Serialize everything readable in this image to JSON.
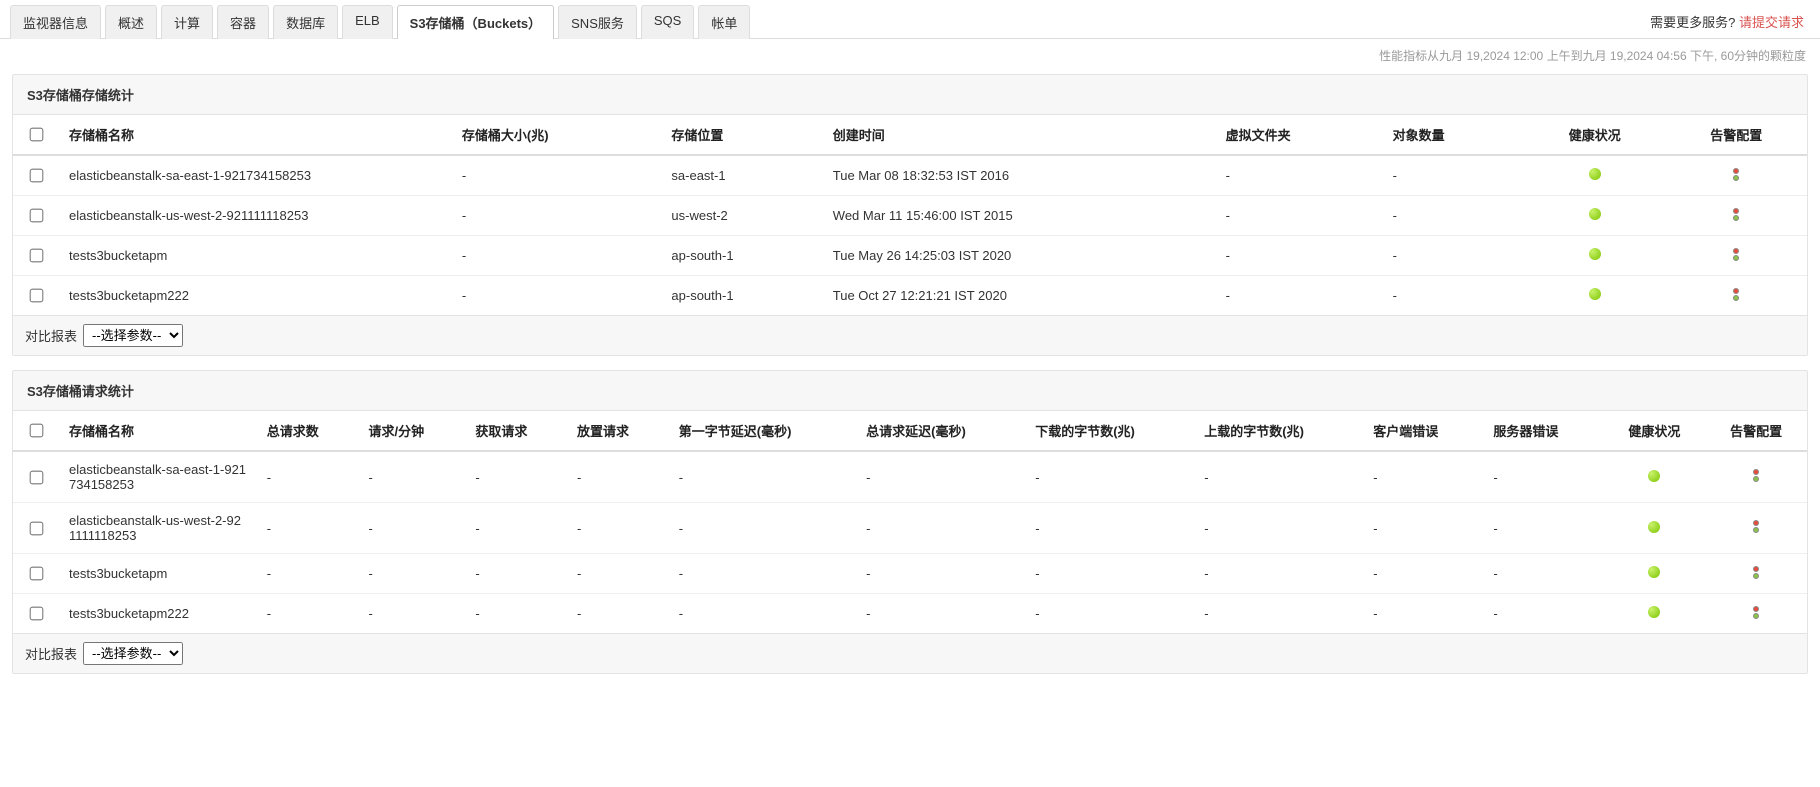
{
  "tabs": {
    "items": [
      "监视器信息",
      "概述",
      "计算",
      "容器",
      "数据库",
      "ELB",
      "S3存储桶（Buckets）",
      "SNS服务",
      "SQS",
      "帐单"
    ],
    "active_index": 6
  },
  "more_services": {
    "prefix": "需要更多服务? ",
    "link": "请提交请求"
  },
  "subbar": "性能指标从九月 19,2024 12:00 上午到九月 19,2024 04:56 下午,   60分钟的颗粒度",
  "storage_panel": {
    "title": "S3存储桶存储统计",
    "headers": [
      "存储桶名称",
      "存储桶大小(兆)",
      "存储位置",
      "创建时间",
      "虚拟文件夹",
      "对象数量",
      "健康状况",
      "告警配置"
    ],
    "rows": [
      {
        "name": "elasticbeanstalk-sa-east-1-921734158253",
        "size": "-",
        "location": "sa-east-1",
        "ctime": "Tue Mar 08 18:32:53 IST 2016",
        "vf": "-",
        "objs": "-"
      },
      {
        "name": "elasticbeanstalk-us-west-2-921111118253",
        "size": "-",
        "location": "us-west-2",
        "ctime": "Wed Mar 11 15:46:00 IST 2015",
        "vf": "-",
        "objs": "-"
      },
      {
        "name": "tests3bucketapm",
        "size": "-",
        "location": "ap-south-1",
        "ctime": "Tue May 26 14:25:03 IST 2020",
        "vf": "-",
        "objs": "-"
      },
      {
        "name": "tests3bucketapm222",
        "size": "-",
        "location": "ap-south-1",
        "ctime": "Tue Oct 27 12:21:21 IST 2020",
        "vf": "-",
        "objs": "-"
      }
    ],
    "footer_label": "对比报表",
    "footer_select": "--选择参数--"
  },
  "request_panel": {
    "title": "S3存储桶请求统计",
    "headers": [
      "存储桶名称",
      "总请求数",
      "请求/分钟",
      "获取请求",
      "放置请求",
      "第一字节延迟(毫秒)",
      "总请求延迟(毫秒)",
      "下载的字节数(兆)",
      "上载的字节数(兆)",
      "客户端错误",
      "服务器错误",
      "健康状况",
      "告警配置"
    ],
    "rows": [
      {
        "name": "elasticbeanstalk-sa-east-1-921734158253",
        "v": [
          "-",
          "-",
          "-",
          "-",
          "-",
          "-",
          "-",
          "-",
          "-",
          "-"
        ]
      },
      {
        "name": "elasticbeanstalk-us-west-2-921111118253",
        "v": [
          "-",
          "-",
          "-",
          "-",
          "-",
          "-",
          "-",
          "-",
          "-",
          "-"
        ]
      },
      {
        "name": "tests3bucketapm",
        "v": [
          "-",
          "-",
          "-",
          "-",
          "-",
          "-",
          "-",
          "-",
          "-",
          "-"
        ]
      },
      {
        "name": "tests3bucketapm222",
        "v": [
          "-",
          "-",
          "-",
          "-",
          "-",
          "-",
          "-",
          "-",
          "-",
          "-"
        ]
      }
    ],
    "footer_label": "对比报表",
    "footer_select": "--选择参数--"
  }
}
